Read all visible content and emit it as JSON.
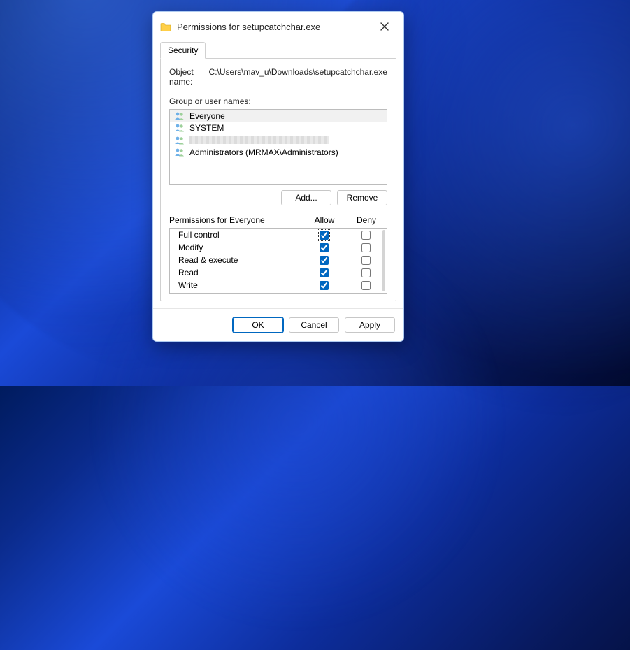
{
  "title": "Permissions for setupcatchchar.exe",
  "tabs": {
    "security": "Security"
  },
  "objectNameLabel": "Object name:",
  "objectName": "C:\\Users\\mav_u\\Downloads\\setupcatchchar.exe",
  "groupLabel": "Group or user names:",
  "groups": [
    {
      "name": "Everyone",
      "redacted": false
    },
    {
      "name": "SYSTEM",
      "redacted": false
    },
    {
      "name": "",
      "redacted": true
    },
    {
      "name": "Administrators (MRMAX\\Administrators)",
      "redacted": false
    }
  ],
  "buttons": {
    "add": "Add...",
    "remove": "Remove",
    "ok": "OK",
    "cancel": "Cancel",
    "apply": "Apply"
  },
  "permHeader": {
    "title": "Permissions for Everyone",
    "allow": "Allow",
    "deny": "Deny"
  },
  "perms": [
    {
      "name": "Full control",
      "allow": true,
      "deny": false,
      "focus": true
    },
    {
      "name": "Modify",
      "allow": true,
      "deny": false
    },
    {
      "name": "Read & execute",
      "allow": true,
      "deny": false
    },
    {
      "name": "Read",
      "allow": true,
      "deny": false
    },
    {
      "name": "Write",
      "allow": true,
      "deny": false
    }
  ]
}
